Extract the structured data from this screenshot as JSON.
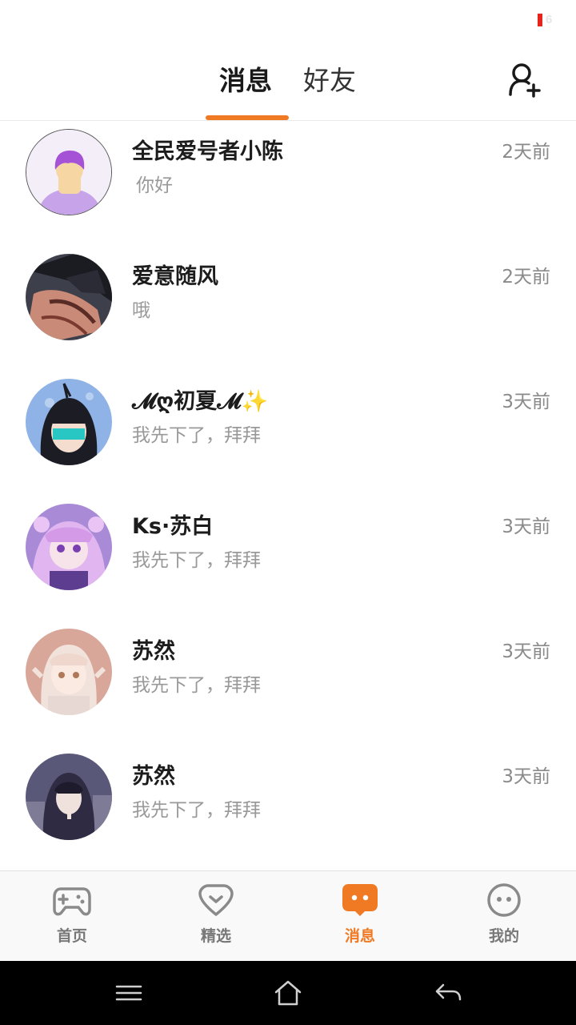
{
  "status_bar": {
    "battery_text": "6",
    "battery_color": "#e8231c"
  },
  "header": {
    "tabs": [
      {
        "label": "消息",
        "active": true
      },
      {
        "label": "好友",
        "active": false
      }
    ],
    "accent_color": "#f07a24",
    "add_friend_icon": "add-user-icon"
  },
  "conversations": [
    {
      "name": "全民爱号者小陈",
      "preview": "你好",
      "time": "2天前",
      "avatar": "default-avatar"
    },
    {
      "name": "爱意随风",
      "preview": "哦",
      "time": "2天前",
      "avatar": "anime-boy-avatar"
    },
    {
      "name": "𝓜ღ初夏𝓜✨",
      "preview": "我先下了，拜拜",
      "time": "3天前",
      "avatar": "anime-girl-avatar"
    },
    {
      "name": "Ks·苏白",
      "preview": "我先下了，拜拜",
      "time": "3天前",
      "avatar": "anime-girl-avatar"
    },
    {
      "name": "苏然",
      "preview": "我先下了，拜拜",
      "time": "3天前",
      "avatar": "anime-girl-avatar"
    },
    {
      "name": "苏然",
      "preview": "我先下了，拜拜",
      "time": "3天前",
      "avatar": "anime-boy-avatar"
    }
  ],
  "bottom_nav": [
    {
      "label": "首页",
      "icon": "gamepad-icon",
      "active": false
    },
    {
      "label": "精选",
      "icon": "heart-icon",
      "active": false
    },
    {
      "label": "消息",
      "icon": "chat-bubble-icon",
      "active": true
    },
    {
      "label": "我的",
      "icon": "face-icon",
      "active": false
    }
  ],
  "system_nav": [
    "menu-icon",
    "home-icon",
    "back-icon"
  ]
}
